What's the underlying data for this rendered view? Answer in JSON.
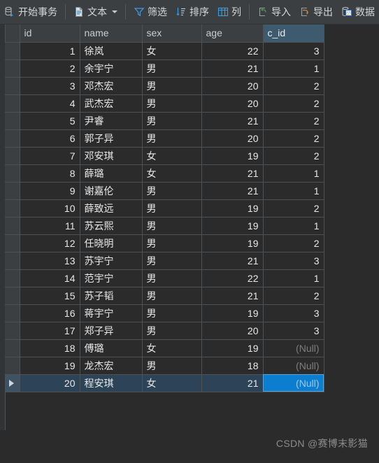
{
  "toolbar": {
    "items": [
      {
        "label": "开始事务",
        "icon": "start-transaction-icon"
      },
      {
        "label": "文本",
        "icon": "text-icon",
        "caret": true
      },
      {
        "label": "筛选",
        "icon": "filter-icon"
      },
      {
        "label": "排序",
        "icon": "sort-icon"
      },
      {
        "label": "列",
        "icon": "columns-icon"
      },
      {
        "label": "导入",
        "icon": "import-icon"
      },
      {
        "label": "导出",
        "icon": "export-icon"
      },
      {
        "label": "数据",
        "icon": "data-generator-icon"
      }
    ]
  },
  "grid": {
    "columns": [
      "id",
      "name",
      "sex",
      "age",
      "c_id"
    ],
    "selected_column": "c_id",
    "selected_row_index": 19,
    "selected_cell_column": "c_id",
    "null_label": "(Null)",
    "rows": [
      {
        "id": "1",
        "name": "徐岚",
        "sex": "女",
        "age": "22",
        "c_id": "3"
      },
      {
        "id": "2",
        "name": "余宇宁",
        "sex": "男",
        "age": "21",
        "c_id": "1"
      },
      {
        "id": "3",
        "name": "邓杰宏",
        "sex": "男",
        "age": "20",
        "c_id": "2"
      },
      {
        "id": "4",
        "name": "武杰宏",
        "sex": "男",
        "age": "20",
        "c_id": "2"
      },
      {
        "id": "5",
        "name": "尹睿",
        "sex": "男",
        "age": "21",
        "c_id": "2"
      },
      {
        "id": "6",
        "name": "郭子异",
        "sex": "男",
        "age": "20",
        "c_id": "2"
      },
      {
        "id": "7",
        "name": "邓安琪",
        "sex": "女",
        "age": "19",
        "c_id": "2"
      },
      {
        "id": "8",
        "name": "薛璐",
        "sex": "女",
        "age": "21",
        "c_id": "1"
      },
      {
        "id": "9",
        "name": "谢嘉伦",
        "sex": "男",
        "age": "21",
        "c_id": "1"
      },
      {
        "id": "10",
        "name": "薛致远",
        "sex": "男",
        "age": "19",
        "c_id": "2"
      },
      {
        "id": "11",
        "name": "苏云熙",
        "sex": "男",
        "age": "19",
        "c_id": "1"
      },
      {
        "id": "12",
        "name": "任晓明",
        "sex": "男",
        "age": "19",
        "c_id": "2"
      },
      {
        "id": "13",
        "name": "苏宇宁",
        "sex": "男",
        "age": "21",
        "c_id": "3"
      },
      {
        "id": "14",
        "name": "范宇宁",
        "sex": "男",
        "age": "22",
        "c_id": "1"
      },
      {
        "id": "15",
        "name": "苏子韬",
        "sex": "男",
        "age": "21",
        "c_id": "2"
      },
      {
        "id": "16",
        "name": "蒋宇宁",
        "sex": "男",
        "age": "19",
        "c_id": "3"
      },
      {
        "id": "17",
        "name": "郑子异",
        "sex": "男",
        "age": "20",
        "c_id": "3"
      },
      {
        "id": "18",
        "name": "傅璐",
        "sex": "女",
        "age": "19",
        "c_id": "(Null)"
      },
      {
        "id": "19",
        "name": "龙杰宏",
        "sex": "男",
        "age": "18",
        "c_id": "(Null)"
      },
      {
        "id": "20",
        "name": "程安琪",
        "sex": "女",
        "age": "21",
        "c_id": "(Null)"
      }
    ]
  },
  "watermark": {
    "text": "CSDN @赛博末影猫"
  },
  "colors": {
    "toolbar_bg": "#3c3f41",
    "grid_bg": "#2b2b2b",
    "grid_line": "#4e5254",
    "header_selected_bg": "#3d5a6e",
    "row_selected_bg": "#2d4458",
    "cell_selected_bg": "#0b7ed0",
    "accent_blue": "#4d9ee0",
    "accent_green": "#5aa85a",
    "accent_orange": "#d8893b",
    "null_text": "#7e7e7e"
  }
}
